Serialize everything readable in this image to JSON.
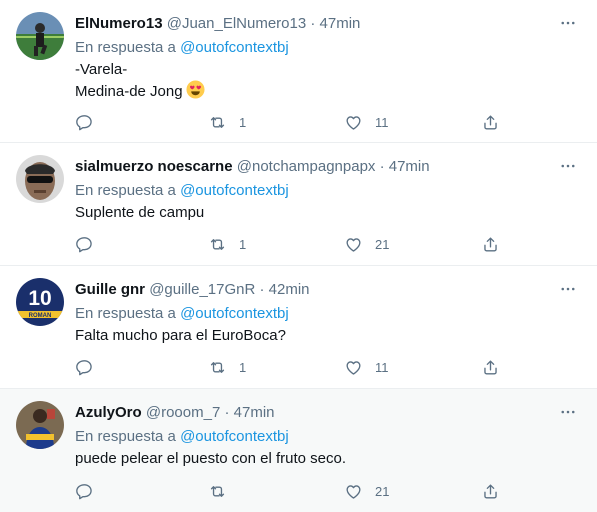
{
  "reply_prefix": "En respuesta a",
  "tweets": [
    {
      "name": "ElNumero13",
      "handle": "@Juan_ElNumero13",
      "separator": "·",
      "time": "47min",
      "mention": "@outofcontextbj",
      "lines": [
        "-Varela-",
        "Medina-de Jong"
      ],
      "emoji": "smiling-face-with-heart-eyes",
      "retweets": "1",
      "likes": "11"
    },
    {
      "name": "sialmuerzo noescarne",
      "handle": "@notchampagnpapx",
      "separator": "·",
      "time": "47min",
      "mention": "@outofcontextbj",
      "lines": [
        "Suplente de campu"
      ],
      "retweets": "1",
      "likes": "21"
    },
    {
      "name": "Guille gnr",
      "handle": "@guille_17GnR",
      "separator": "·",
      "time": "42min",
      "mention": "@outofcontextbj",
      "lines": [
        "Falta mucho para el EuroBoca?"
      ],
      "retweets": "1",
      "likes": "11"
    },
    {
      "name": "AzulyOro",
      "handle": "@rooom_7",
      "separator": "·",
      "time": "47min",
      "mention": "@outofcontextbj",
      "lines": [
        "puede pelear el puesto con el fruto seco."
      ],
      "retweets": "",
      "likes": "21"
    }
  ],
  "avatar_badge_text": "10",
  "avatar_badge_name": "ROMAN",
  "colors": {
    "link": "#1b95e0",
    "muted": "#5b7083",
    "text": "#0f1419",
    "divider": "#ebeef0",
    "hover_bg": "#f7f9f9"
  }
}
